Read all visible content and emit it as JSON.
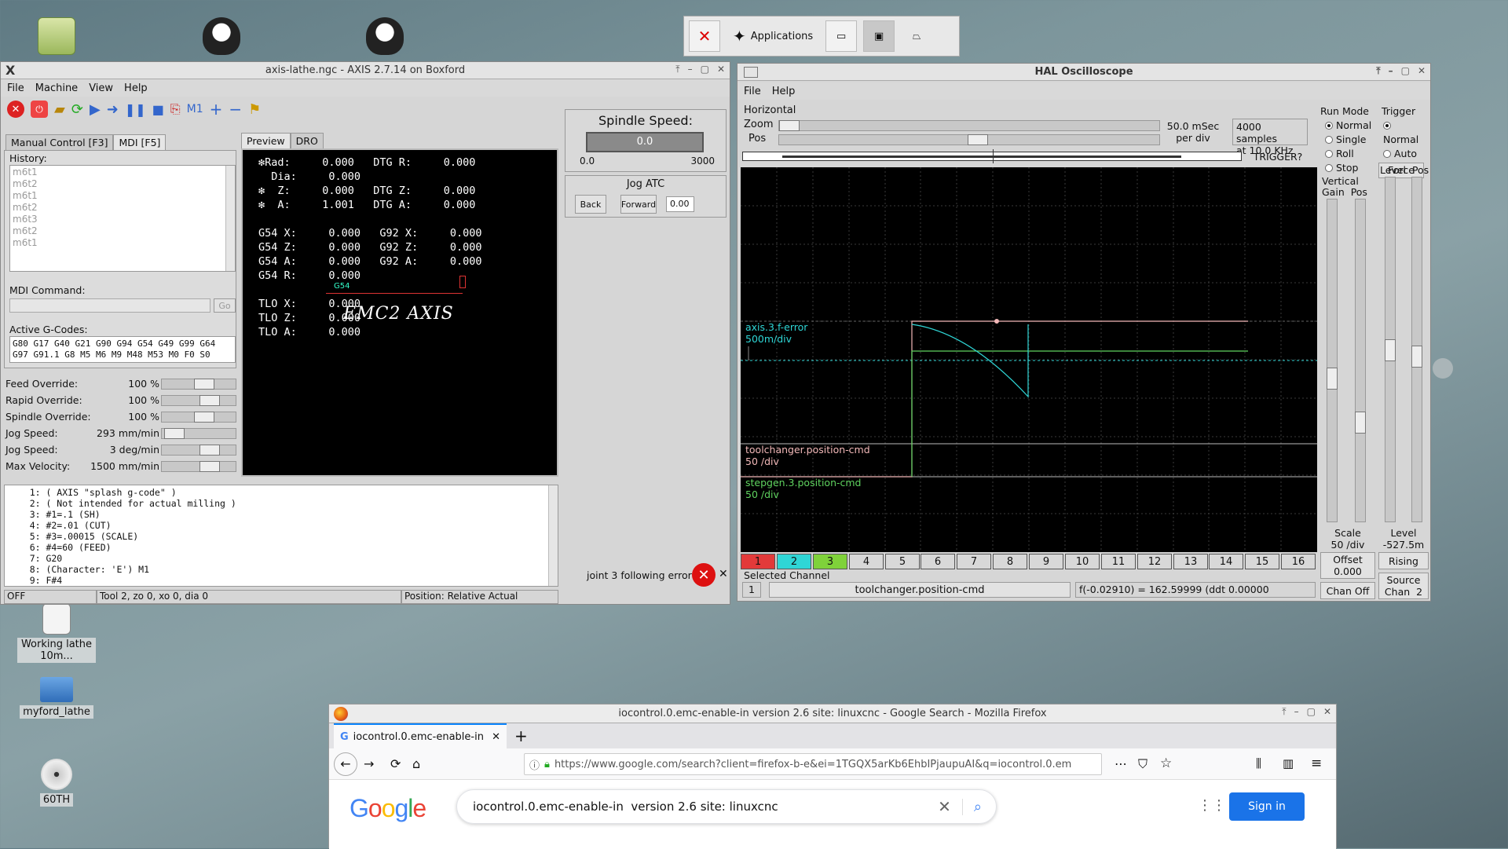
{
  "desktop": {
    "icons": [
      {
        "name": "trash-icon",
        "label": ""
      },
      {
        "name": "penguin-icon-1",
        "label": ""
      },
      {
        "name": "penguin-icon-2",
        "label": ""
      },
      {
        "name": "document-icon",
        "label": "Working lathe 10m..."
      },
      {
        "name": "folder-icon",
        "label": "myford_lathe"
      },
      {
        "name": "disc-icon",
        "label": "60TH"
      }
    ]
  },
  "taskbar": {
    "applications_label": "Applications"
  },
  "axis": {
    "title": "axis-lathe.ngc - AXIS 2.7.14 on Boxford",
    "menu": [
      "File",
      "Machine",
      "View",
      "Help"
    ],
    "tabs_left": [
      "Manual Control [F3]",
      "MDI [F5]"
    ],
    "tabs_right": [
      "Preview",
      "DRO"
    ],
    "history_label": "History:",
    "history": [
      "m6t1",
      "m6t2",
      "m6t1",
      "m6t2",
      "m6t3",
      "m6t2",
      "m6t1"
    ],
    "mdi_command_label": "MDI Command:",
    "go_label": "Go",
    "active_gcodes_label": "Active G-Codes:",
    "active_gcodes_line1": "G80 G17 G40 G21 G90 G94 G54 G49 G99 G64",
    "active_gcodes_line2": "G97 G91.1 G8 M5 M6 M9 M48 M53 M0 F0 S0",
    "overrides": [
      {
        "label": "Feed Override:",
        "value": "100 %",
        "thumb": 0.6
      },
      {
        "label": "Rapid Override:",
        "value": "100 %",
        "thumb": 0.7
      },
      {
        "label": "Spindle Override:",
        "value": "100 %",
        "thumb": 0.6
      },
      {
        "label": "Jog Speed:",
        "value": "293 mm/min",
        "thumb": 0.05
      },
      {
        "label": "Jog Speed:",
        "value": "3 deg/min",
        "thumb": 0.7
      },
      {
        "label": "Max Velocity:",
        "value": "1500 mm/min",
        "thumb": 0.7
      }
    ],
    "dro": [
      "❇Rad:     0.000   DTG R:     0.000",
      "  Dia:     0.000",
      "❇  Z:     0.000   DTG Z:     0.000",
      "❇  A:     1.001   DTG A:     0.000",
      "",
      "G54 X:     0.000   G92 X:     0.000",
      "G54 Z:     0.000   G92 Z:     0.000",
      "G54 A:     0.000   G92 A:     0.000",
      "G54 R:     0.000",
      "",
      "TLO X:     0.000",
      "TLO Z:     0.000",
      "TLO A:     0.000"
    ],
    "preview_logo": "EMC2 AXIS",
    "preview_g54": "G54",
    "spindle_speed_label": "Spindle Speed:",
    "spindle_speed_value": "0.0",
    "spindle_min": "0.0",
    "spindle_max": "3000",
    "jog_atc_label": "Jog ATC",
    "back_label": "Back",
    "forward_label": "Forward",
    "jog_atc_value": "0.00",
    "gcode": [
      "    1: ( AXIS \"splash g-code\" )",
      "    2: ( Not intended for actual milling )",
      "    3: #1=.1 (SH)",
      "    4: #2=.01 (CUT)",
      "    5: #3=.00015 (SCALE)",
      "    6: #4=60 (FEED)",
      "    7: G20",
      "    8: (Character: 'E') M1",
      "    9: F#4"
    ],
    "error_text": "joint 3 following error",
    "status_state": "OFF",
    "status_tool": "Tool 2, zo 0, xo 0, dia 0",
    "status_position": "Position: Relative Actual"
  },
  "scope": {
    "title": "HAL Oscilloscope",
    "menu": [
      "File",
      "Help"
    ],
    "horizontal_label": "Horizontal",
    "zoom_label": "Zoom",
    "pos_label": "Pos",
    "time_per_div_1": "50.0 mSec",
    "time_per_div_2": "per div",
    "samples_1": "4000 samples",
    "samples_2": "at 10.0 KHz",
    "trigger_label": "TRIGGER?",
    "run_mode_label": "Run Mode",
    "run_modes": [
      {
        "label": "Normal",
        "on": true
      },
      {
        "label": "Single",
        "on": false
      },
      {
        "label": "Roll",
        "on": false
      },
      {
        "label": "Stop",
        "on": false
      }
    ],
    "trigger_section_label": "Trigger",
    "trigger_modes": [
      {
        "label": "Normal",
        "on": true
      },
      {
        "label": "Auto",
        "on": false
      }
    ],
    "force_label": "Force",
    "level_pos_label": "Level  Pos",
    "vertical_label": "Vertical",
    "gain_pos_label": "Gain  Pos",
    "traces": [
      {
        "name": "axis.3.f-error",
        "scale": "500m/div",
        "color": "#2fd6d6"
      },
      {
        "name": "toolchanger.position-cmd",
        "scale": "50 /div",
        "color": "#f2b8b8"
      },
      {
        "name": "stepgen.3.position-cmd",
        "scale": "50 /div",
        "color": "#5fd35f"
      }
    ],
    "channels": [
      "1",
      "2",
      "3",
      "4",
      "5",
      "6",
      "7",
      "8",
      "9",
      "10",
      "11",
      "12",
      "13",
      "14",
      "15",
      "16"
    ],
    "channel_colors": [
      "#e23a3a",
      "#2fd6d6",
      "#7fd23a"
    ],
    "selected_channel_label": "Selected Channel",
    "selected_channel_num": "1",
    "selected_channel_name": "toolchanger.position-cmd",
    "readout": "f(-0.02910) =   162.59999 (ddt  0.00000",
    "scale_label": "Scale",
    "scale_value": "50 /div",
    "offset_label": "Offset",
    "offset_value": "0.000",
    "chan_off_label": "Chan Off",
    "level_label": "Level",
    "level_value": "-527.5m",
    "rising_label": "Rising",
    "source_label": "Source",
    "source_value": "Chan  2"
  },
  "firefox": {
    "title": "iocontrol.0.emc-enable-in version 2.6 site: linuxcnc - Google Search - Mozilla Firefox",
    "tab_label": "iocontrol.0.emc-enable-in",
    "url": "https://www.google.com/search?client=firefox-b-e&ei=1TGQX5arKb6EhbIPjaupuAI&q=iocontrol.0.em",
    "search_text": "iocontrol.0.emc-enable-in  version 2.6 site: linuxcnc",
    "sign_in_label": "Sign in",
    "google_colors": [
      "#4285f4",
      "#ea4335",
      "#fbbc05",
      "#4285f4",
      "#34a853",
      "#ea4335"
    ]
  }
}
